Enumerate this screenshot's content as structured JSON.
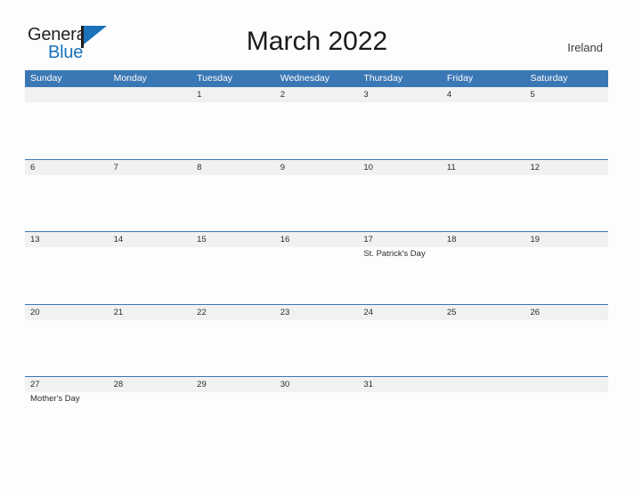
{
  "brand": {
    "name_part1": "General",
    "name_part2": "Blue",
    "mark": "triangle-flag"
  },
  "header": {
    "title": "March 2022",
    "region": "Ireland"
  },
  "calendar": {
    "weekday_headers": [
      "Sunday",
      "Monday",
      "Tuesday",
      "Wednesday",
      "Thursday",
      "Friday",
      "Saturday"
    ],
    "weeks": [
      {
        "days": [
          {
            "number": "",
            "event": ""
          },
          {
            "number": "",
            "event": ""
          },
          {
            "number": "1",
            "event": ""
          },
          {
            "number": "2",
            "event": ""
          },
          {
            "number": "3",
            "event": ""
          },
          {
            "number": "4",
            "event": ""
          },
          {
            "number": "5",
            "event": ""
          }
        ]
      },
      {
        "days": [
          {
            "number": "6",
            "event": ""
          },
          {
            "number": "7",
            "event": ""
          },
          {
            "number": "8",
            "event": ""
          },
          {
            "number": "9",
            "event": ""
          },
          {
            "number": "10",
            "event": ""
          },
          {
            "number": "11",
            "event": ""
          },
          {
            "number": "12",
            "event": ""
          }
        ]
      },
      {
        "days": [
          {
            "number": "13",
            "event": ""
          },
          {
            "number": "14",
            "event": ""
          },
          {
            "number": "15",
            "event": ""
          },
          {
            "number": "16",
            "event": ""
          },
          {
            "number": "17",
            "event": "St. Patrick's Day"
          },
          {
            "number": "18",
            "event": ""
          },
          {
            "number": "19",
            "event": ""
          }
        ]
      },
      {
        "days": [
          {
            "number": "20",
            "event": ""
          },
          {
            "number": "21",
            "event": ""
          },
          {
            "number": "22",
            "event": ""
          },
          {
            "number": "23",
            "event": ""
          },
          {
            "number": "24",
            "event": ""
          },
          {
            "number": "25",
            "event": ""
          },
          {
            "number": "26",
            "event": ""
          }
        ]
      },
      {
        "days": [
          {
            "number": "27",
            "event": "Mother's Day"
          },
          {
            "number": "28",
            "event": ""
          },
          {
            "number": "29",
            "event": ""
          },
          {
            "number": "30",
            "event": ""
          },
          {
            "number": "31",
            "event": ""
          },
          {
            "number": "",
            "event": ""
          },
          {
            "number": "",
            "event": ""
          }
        ]
      }
    ]
  },
  "colors": {
    "header_blue": "#3a77b5",
    "brand_blue": "#1a72ba",
    "daynum_band": "#f1f1f1",
    "page_background": "#fdfdfd"
  }
}
